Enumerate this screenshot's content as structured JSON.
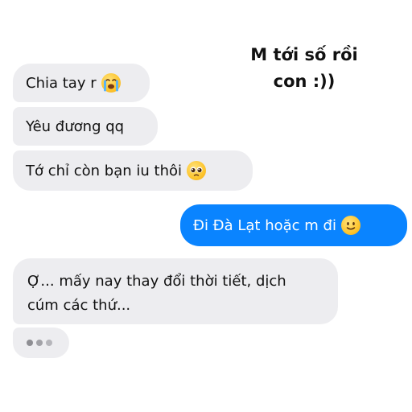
{
  "caption": {
    "line1": "M tới số rồi",
    "line2": "con :))"
  },
  "messages": [
    {
      "sender": "them",
      "text": "Chia tay r",
      "emoji": "loudly-crying-face-icon"
    },
    {
      "sender": "them",
      "text": "Yêu đương qq"
    },
    {
      "sender": "them",
      "text": "Tớ chỉ còn bạn iu thôi",
      "emoji": "pleading-face-icon"
    },
    {
      "sender": "me",
      "text": "Đi Đà Lạt hoặc m đi",
      "emoji": "slightly-smiling-face-icon"
    },
    {
      "sender": "them",
      "line1": "Ợ... mấy nay thay đổi thời tiết, dịch",
      "line2": "cúm các thứ..."
    }
  ],
  "typing_indicator": {
    "dots": 3
  },
  "colors": {
    "incoming_bubble": "#ededf0",
    "outgoing_bubble": "#0a84ff",
    "outgoing_text": "#ffffff",
    "text": "#111111"
  }
}
